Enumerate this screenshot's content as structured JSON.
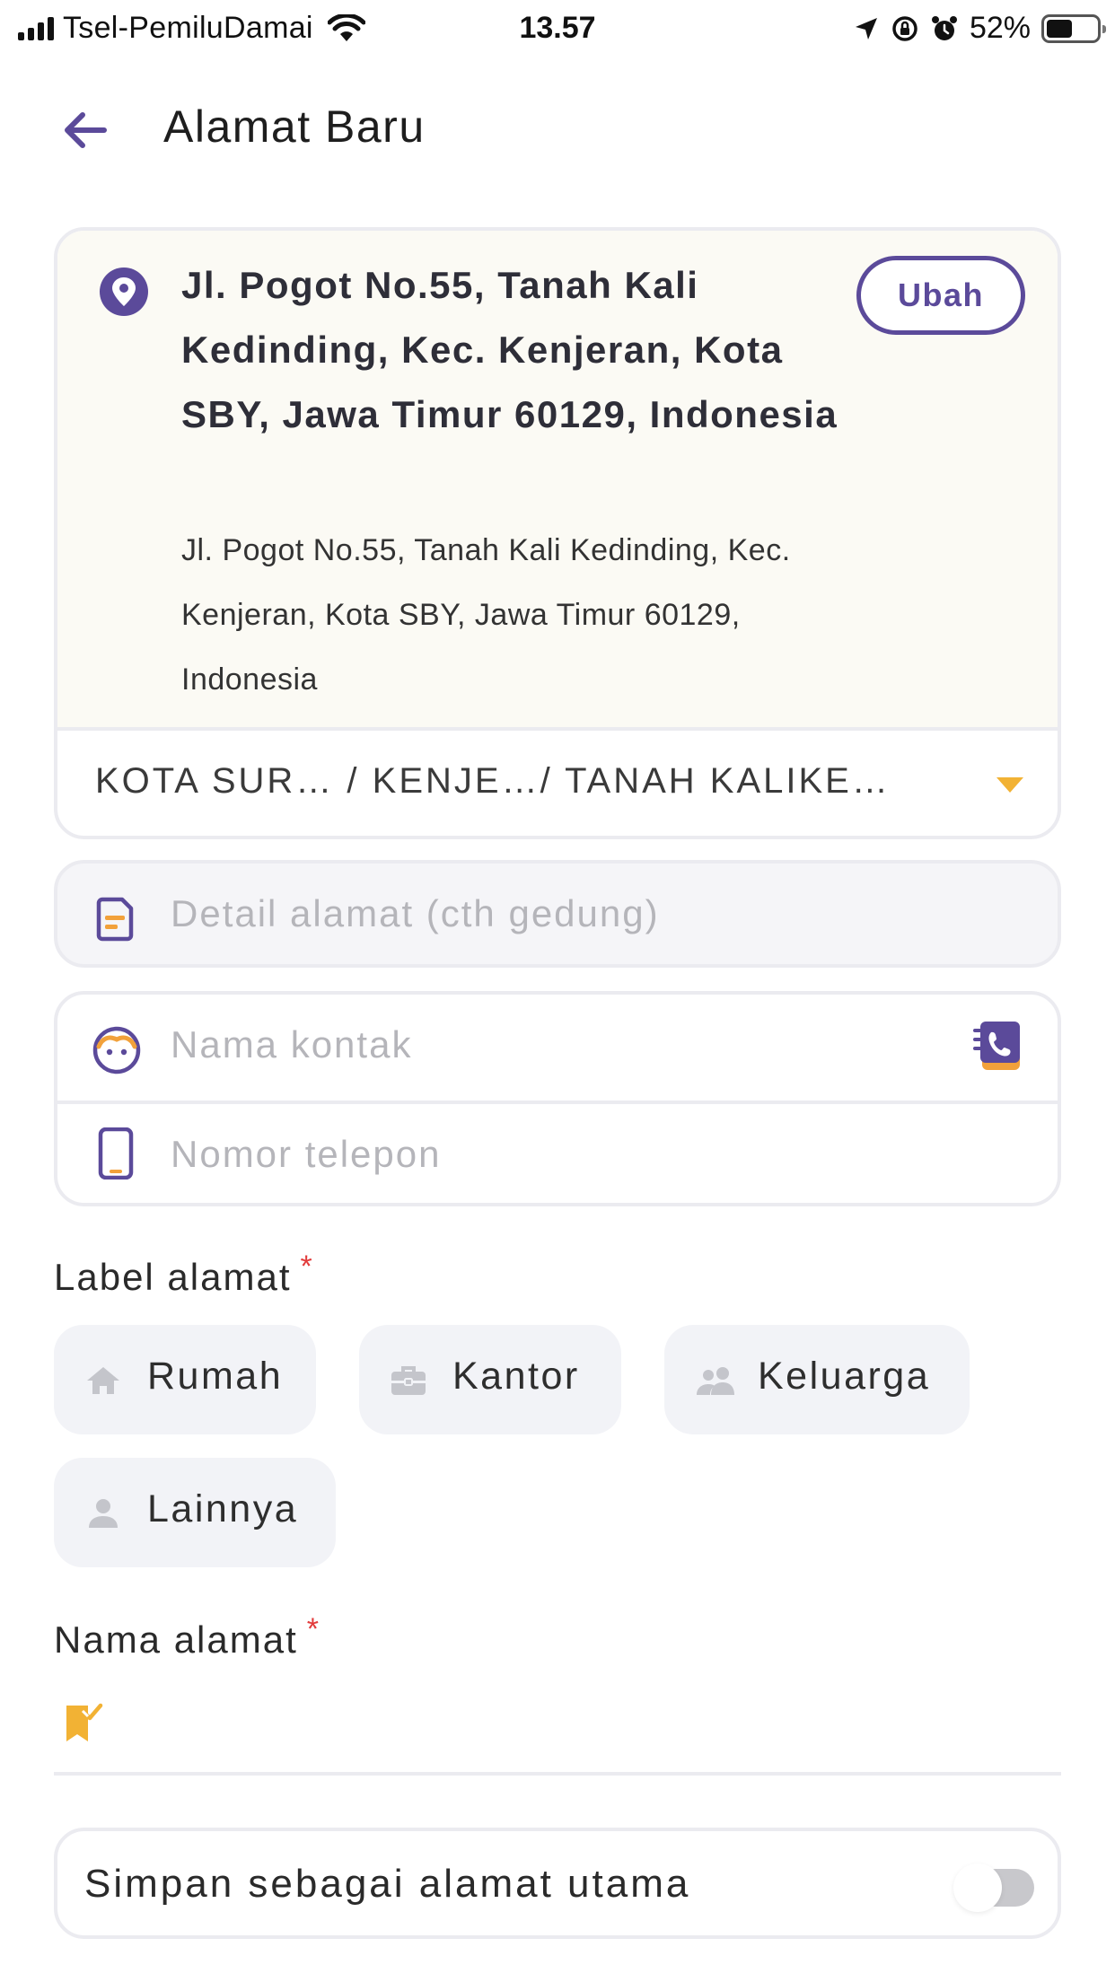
{
  "status_bar": {
    "carrier": "Tsel-PemiluDamai",
    "time": "13.57",
    "battery_percent": "52%",
    "battery_level": 0.52
  },
  "header": {
    "title": "Alamat Baru",
    "back_icon": "arrow-left-icon"
  },
  "address": {
    "main": "Jl. Pogot No.55, Tanah Kali Kedinding, Kec. Kenjeran, Kota SBY, Jawa Timur 60129, Indonesia",
    "sub": "Jl. Pogot No.55, Tanah Kali Kedinding, Kec. Kenjeran, Kota SBY, Jawa Timur 60129, Indonesia",
    "change_label": "Ubah",
    "area": "KOTA SUR…  / KENJE…/ TANAH KALIKE…"
  },
  "fields": {
    "detail_placeholder": "Detail alamat (cth gedung)",
    "contact_name_placeholder": "Nama kontak",
    "phone_placeholder": "Nomor telepon"
  },
  "label_section": {
    "title": "Label alamat",
    "required_mark": "*",
    "chips": [
      {
        "label": "Rumah",
        "icon": "home-icon"
      },
      {
        "label": "Kantor",
        "icon": "briefcase-icon"
      },
      {
        "label": "Keluarga",
        "icon": "people-icon"
      },
      {
        "label": "Lainnya",
        "icon": "person-icon"
      }
    ]
  },
  "name_section": {
    "title": "Nama alamat",
    "required_mark": "*",
    "value": ""
  },
  "primary_toggle": {
    "label": "Simpan sebagai alamat utama",
    "on": false
  },
  "colors": {
    "accent": "#5b4a9a",
    "accent_orange": "#f2b234",
    "required": "#e23b3b",
    "card_bg": "#fbfaf4",
    "border": "#ebebf0",
    "chip_bg": "#f2f3f7"
  }
}
